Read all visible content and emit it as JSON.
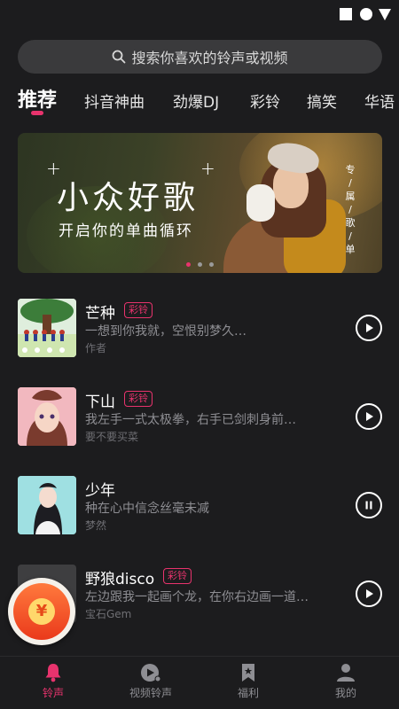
{
  "search": {
    "placeholder": "搜索你喜欢的铃声或视频"
  },
  "tabs": [
    {
      "label": "推荐",
      "active": true
    },
    {
      "label": "抖音神曲"
    },
    {
      "label": "劲爆DJ"
    },
    {
      "label": "彩铃"
    },
    {
      "label": "搞笑"
    },
    {
      "label": "华语"
    }
  ],
  "banner": {
    "title": "小众好歌",
    "subtitle": "开启你的单曲循环",
    "side_text": [
      "专",
      "属",
      "歌",
      "单"
    ],
    "page_count": 3,
    "active_page": 1
  },
  "songs": [
    {
      "name": "芒种",
      "badge": "彩铃",
      "lyric": "一想到你我就，空恨别梦久…",
      "artist": "作者",
      "state": "play"
    },
    {
      "name": "下山",
      "badge": "彩铃",
      "lyric": "我左手一式太极拳，右手已剑刺身前…",
      "artist": "要不要买菜",
      "state": "play"
    },
    {
      "name": "少年",
      "badge": "",
      "lyric": "种在心中信念丝毫未减",
      "artist": "梦然",
      "state": "pause"
    },
    {
      "name": "野狼disco",
      "badge": "彩铃",
      "lyric": "左边跟我一起画个龙，在你右边画一道…",
      "artist": "宝石Gem",
      "state": "play"
    }
  ],
  "floating": {
    "coin_symbol": "¥"
  },
  "nav": [
    {
      "label": "铃声",
      "icon": "bell-icon",
      "active": true
    },
    {
      "label": "视频铃声",
      "icon": "video-music-icon"
    },
    {
      "label": "福利",
      "icon": "bookmark-icon"
    },
    {
      "label": "我的",
      "icon": "person-icon"
    }
  ],
  "colors": {
    "accent": "#e8336d",
    "background": "#1c1c1e",
    "search_bg": "#3a3a3c"
  }
}
